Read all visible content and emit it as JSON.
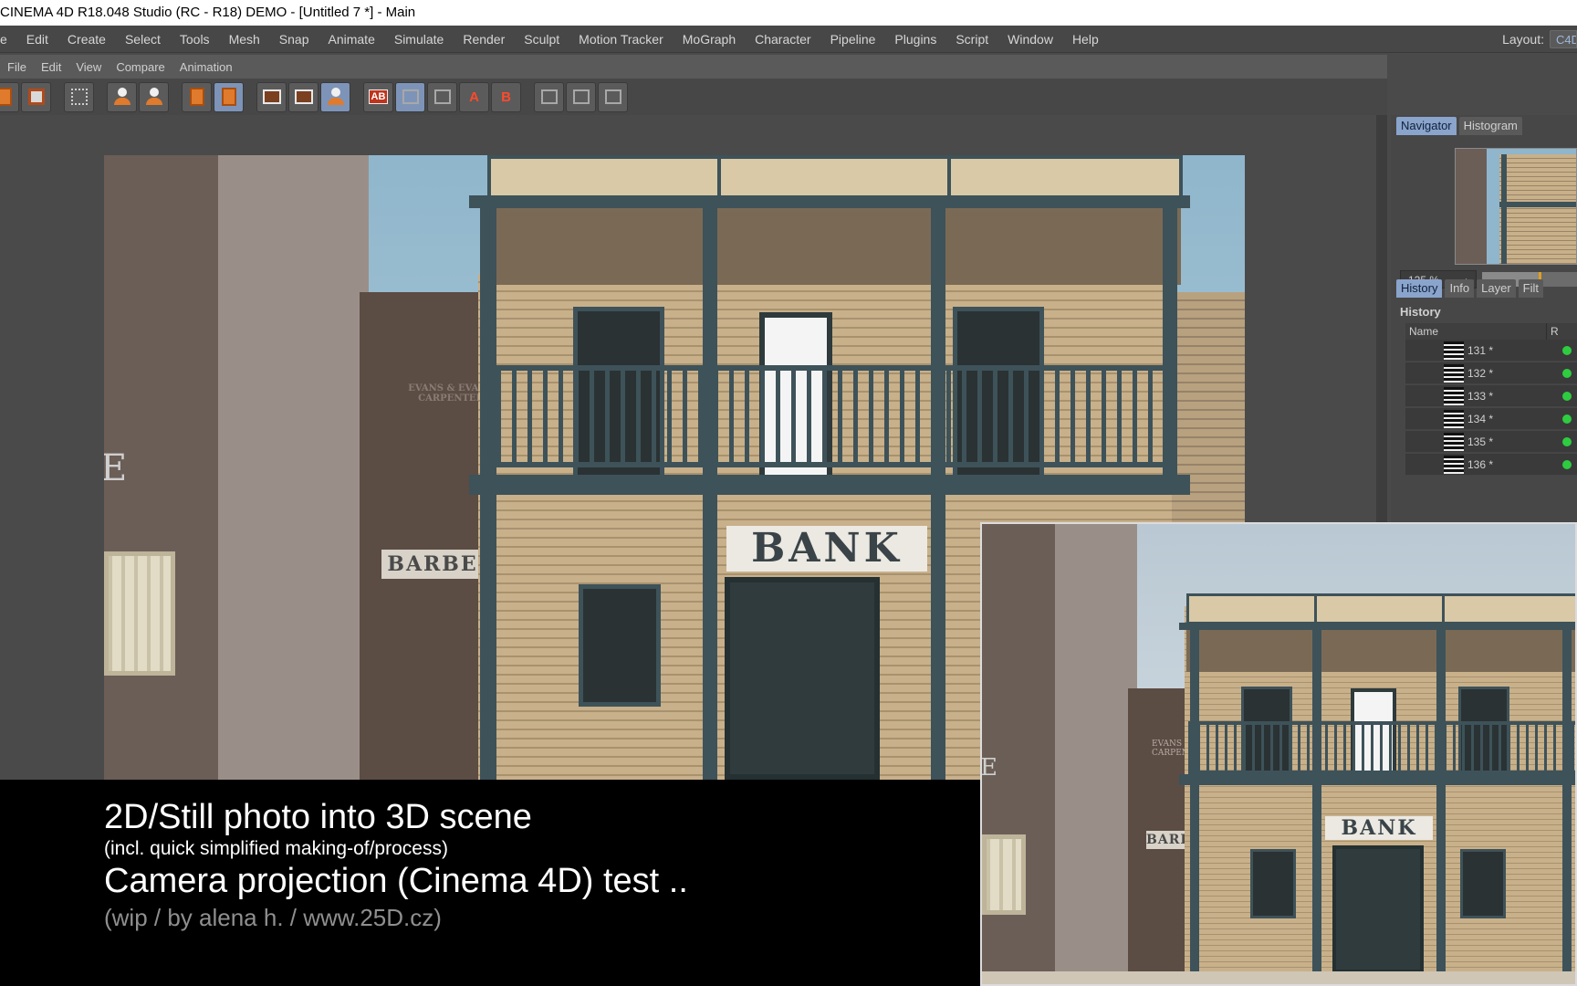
{
  "window": {
    "title": "CINEMA 4D R18.048 Studio (RC - R18) DEMO - [Untitled 7 *] - Main"
  },
  "main_menu": {
    "items": [
      "e",
      "Edit",
      "Create",
      "Select",
      "Tools",
      "Mesh",
      "Snap",
      "Animate",
      "Simulate",
      "Render",
      "Sculpt",
      "Motion Tracker",
      "MoGraph",
      "Character",
      "Pipeline",
      "Plugins",
      "Script",
      "Window",
      "Help"
    ],
    "layout_label": "Layout:",
    "layout_value": "C4D"
  },
  "viewer_menu": {
    "items": [
      "File",
      "Edit",
      "View",
      "Compare",
      "Animation"
    ]
  },
  "scene": {
    "bank_sign": "BANK",
    "barber_sign": "BARBE",
    "carpenter_sign": "EVANS & EVANS CARPENTER",
    "partial_letter": "E"
  },
  "inset": {
    "bank_sign": "BANK",
    "barber_sign": "BARBER",
    "carpenter_sign": "EVANS & CARPEN",
    "partial_letter": "E"
  },
  "right_panel": {
    "top_tabs": [
      "Navigator",
      "Histogram"
    ],
    "zoom_value": "125 %",
    "zoom_fraction": 0.6,
    "history_tabs": [
      "History",
      "Info",
      "Layer",
      "Filt"
    ],
    "history_title": "History",
    "col_name": "Name",
    "col_r": "R",
    "history_rows": [
      "131 *",
      "132 *",
      "133 *",
      "134 *",
      "135 *",
      "136 *"
    ],
    "status_color": "#2ecc40"
  },
  "caption": {
    "line1": "2D/Still photo into 3D scene",
    "line2": "(incl. quick simplified making-of/process)",
    "line3": "Camera projection (Cinema 4D) test ..",
    "line4": "(wip / by alena h. / www.25D.cz)"
  }
}
